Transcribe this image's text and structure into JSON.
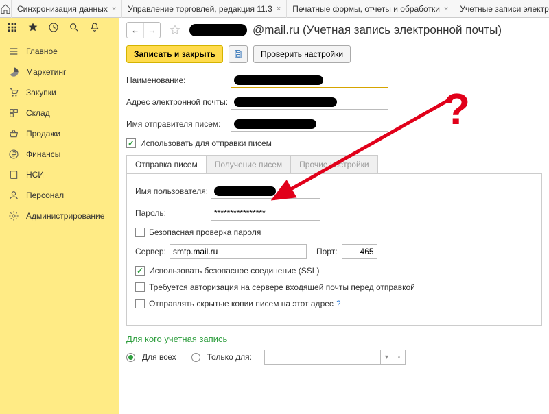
{
  "tabs": {
    "t0": "Синхронизация данных",
    "t1": "Управление торговлей, редакция 11.3",
    "t2": "Печатные формы, отчеты и обработки",
    "t3": "Учетные записи электр"
  },
  "sidebar": {
    "items": [
      {
        "label": "Главное"
      },
      {
        "label": "Маркетинг"
      },
      {
        "label": "Закупки"
      },
      {
        "label": "Склад"
      },
      {
        "label": "Продажи"
      },
      {
        "label": "Финансы"
      },
      {
        "label": "НСИ"
      },
      {
        "label": "Персонал"
      },
      {
        "label": "Администрирование"
      }
    ]
  },
  "page": {
    "title_suffix": "@mail.ru (Учетная запись электронной почты)"
  },
  "toolbar": {
    "save_close": "Записать и закрыть",
    "check": "Проверить настройки"
  },
  "form": {
    "name_label": "Наименование:",
    "email_label": "Адрес электронной почты:",
    "sender_label": "Имя отправителя писем:",
    "use_send": "Использовать для отправки писем"
  },
  "tabs2": {
    "send": "Отправка писем",
    "recv": "Получение писем",
    "other": "Прочие настройки"
  },
  "send": {
    "user_label": "Имя пользователя:",
    "pass_label": "Пароль:",
    "pass_value": "****************",
    "safe_check": "Безопасная проверка пароля",
    "server_label": "Сервер:",
    "server_value": "smtp.mail.ru",
    "port_label": "Порт:",
    "port_value": "465",
    "ssl": "Использовать безопасное соединение (SSL)",
    "auth_in": "Требуется авторизация на сервере входящей почты перед отправкой",
    "bcc": "Отправлять скрытые копии писем на этот адрес"
  },
  "scope": {
    "title": "Для кого учетная запись",
    "all": "Для всех",
    "only": "Только для:"
  },
  "annot": {
    "q": "?"
  }
}
